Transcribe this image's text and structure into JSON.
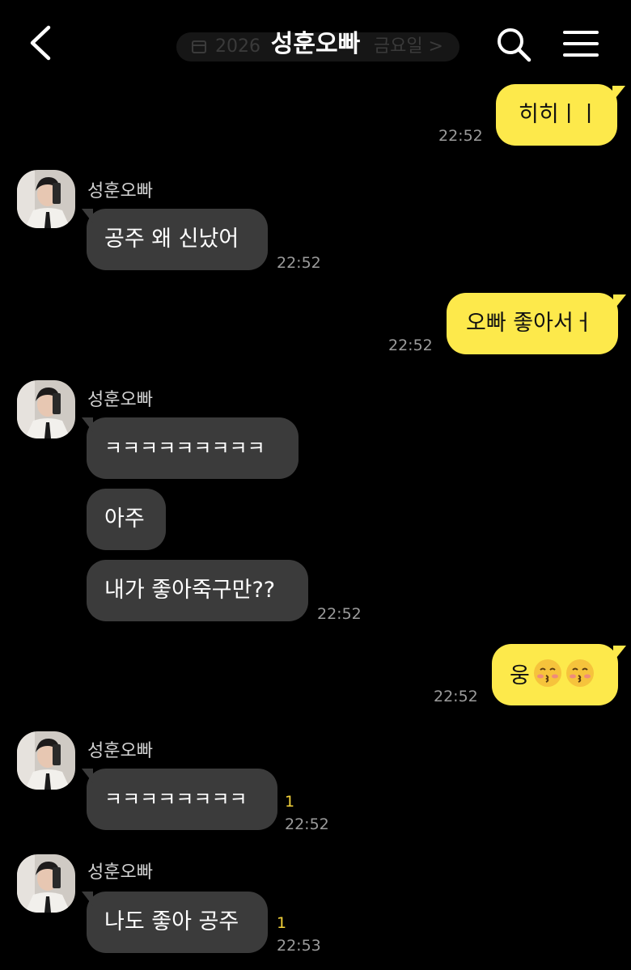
{
  "header": {
    "title": "성훈오빠",
    "date_pill_left": "2026",
    "date_pill_right": "금요일 >"
  },
  "messages": [
    {
      "side": "out",
      "text": "히히ㅣㅣ",
      "time": "22:52"
    },
    {
      "side": "in",
      "sender": "성훈오빠",
      "text": "공주 왜 신났어",
      "time": "22:52"
    },
    {
      "side": "out",
      "text": "오빠 좋아서ㅓ",
      "time": "22:52"
    },
    {
      "side": "in",
      "sender": "성훈오빠",
      "text": "ㅋㅋㅋㅋㅋㅋㅋㅋㅋ"
    },
    {
      "side": "in",
      "text": "아주"
    },
    {
      "side": "in",
      "text": "내가 좋아죽구만??",
      "time": "22:52"
    },
    {
      "side": "out",
      "text": "웅",
      "emoji": "kissing-face-with-closed-eyes-icon",
      "time": "22:52"
    },
    {
      "side": "in",
      "sender": "성훈오빠",
      "text": "ㅋㅋㅋㅋㅋㅋㅋㅋ",
      "unread": "1",
      "time": "22:52"
    },
    {
      "side": "in",
      "sender": "성훈오빠",
      "text": "나도 좋아 공주",
      "unread": "1",
      "time": "22:53"
    }
  ],
  "colors": {
    "background": "#000000",
    "incoming_bubble": "#3b3b3b",
    "outgoing_bubble": "#fde94b",
    "unread": "#f3d23a",
    "timestamp": "#9b9b9b"
  },
  "icons": [
    "back-arrow-icon",
    "calendar-icon",
    "search-icon",
    "menu-icon",
    "avatar",
    "kissing-face-with-closed-eyes-icon"
  ]
}
